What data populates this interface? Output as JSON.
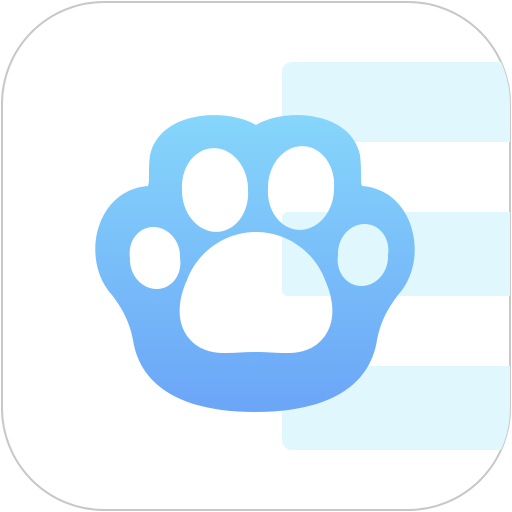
{
  "icon": {
    "name": "paw-print-app-icon",
    "symbol": "paw-icon"
  },
  "colors": {
    "tile_background": "#ffffff",
    "tile_border": "#c8c8c8",
    "stripe_fill": "#e0f7fd",
    "paw_gradient_top": "#86d6fb",
    "paw_gradient_bottom": "#6ba5f7",
    "paw_holes": "#ffffff"
  }
}
